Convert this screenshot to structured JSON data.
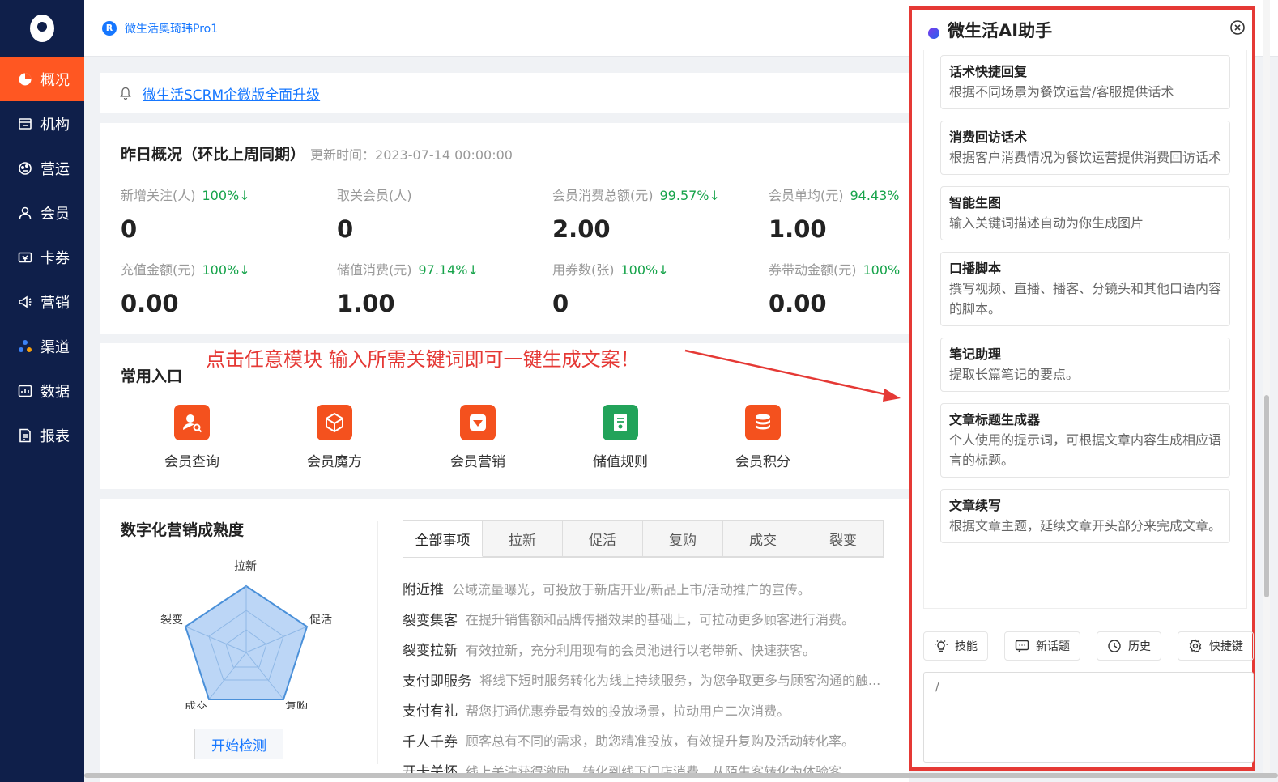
{
  "sidebar": {
    "items": [
      {
        "label": "概况",
        "icon": "pie-chart-icon",
        "active": true
      },
      {
        "label": "机构",
        "icon": "building-icon"
      },
      {
        "label": "营运",
        "icon": "operations-icon"
      },
      {
        "label": "会员",
        "icon": "user-icon"
      },
      {
        "label": "卡券",
        "icon": "coupon-icon"
      },
      {
        "label": "营销",
        "icon": "megaphone-icon"
      },
      {
        "label": "渠道",
        "icon": "channel-icon"
      },
      {
        "label": "数据",
        "icon": "data-icon"
      },
      {
        "label": "报表",
        "icon": "report-icon"
      }
    ],
    "active_color": "#ff5722",
    "bg_color": "#0f1f4a"
  },
  "topbar": {
    "org_badge": "R",
    "org_name": "微生活奥琦玮Pro1"
  },
  "notice": {
    "text": "微生活SCRM企微版全面升级"
  },
  "overview": {
    "title": "昨日概况（环比上周同期）",
    "update_time": "更新时间：2023-07-14 00:00:00",
    "metrics": [
      {
        "label": "新增关注(人)",
        "change": "100%↓",
        "value": "0"
      },
      {
        "label": "取关会员(人)",
        "change": "",
        "value": "0"
      },
      {
        "label": "会员消费总额(元)",
        "change": "99.57%↓",
        "value": "2.00"
      },
      {
        "label": "会员单均(元)",
        "change": "94.43%",
        "value": "1.00"
      },
      {
        "label": "充值金额(元)",
        "change": "100%↓",
        "value": "0.00"
      },
      {
        "label": "储值消费(元)",
        "change": "97.14%↓",
        "value": "1.00"
      },
      {
        "label": "用券数(张)",
        "change": "100%↓",
        "value": "0"
      },
      {
        "label": "券带动金额(元)",
        "change": "100%",
        "value": "0.00"
      }
    ],
    "positive_color": "#16a34a"
  },
  "entries": {
    "title": "常用入口",
    "callout": "点击任意模块 输入所需关键词即可一键生成文案！",
    "items": [
      {
        "label": "会员查询",
        "icon": "member-search-icon",
        "color": "#f4511e"
      },
      {
        "label": "会员魔方",
        "icon": "cube-icon",
        "color": "#f4511e"
      },
      {
        "label": "会员营销",
        "icon": "gem-icon",
        "color": "#f4511e"
      },
      {
        "label": "储值规则",
        "icon": "rules-icon",
        "color": "#22a35a"
      },
      {
        "label": "会员积分",
        "icon": "coins-icon",
        "color": "#f4511e"
      }
    ]
  },
  "maturity": {
    "title": "数字化营销成熟度",
    "radar_labels": [
      "拉新",
      "促活",
      "复购",
      "成交",
      "裂变"
    ],
    "detect_button": "开始检测",
    "tabs": [
      "全部事项",
      "拉新",
      "促活",
      "复购",
      "成交",
      "裂变"
    ],
    "rows": [
      {
        "name": "附近推",
        "desc": "公域流量曝光，可投放于新店开业/新品上市/活动推广的宣传。"
      },
      {
        "name": "裂变集客",
        "desc": "在提升销售额和品牌传播效果的基础上，可拉动更多顾客进行消费。"
      },
      {
        "name": "裂变拉新",
        "desc": "有效拉新，充分利用现有的会员池进行以老带新、快速获客。"
      },
      {
        "name": "支付即服务",
        "desc": "将线下短时服务转化为线上持续服务，为您争取更多与顾客沟通的触..."
      },
      {
        "name": "支付有礼",
        "desc": "帮您打通优惠券最有效的投放场景，拉动用户二次消费。"
      },
      {
        "name": "千人千券",
        "desc": "顾客总有不同的需求，助您精准投放，有效提升复购及活动转化率。"
      },
      {
        "name": "开卡关怀",
        "desc": "线上关注获得激励，转化到线下门店消费，从陌生客转化为体验客。"
      }
    ]
  },
  "ai_panel": {
    "title": "微生活AI助手",
    "skills": [
      {
        "name": "话术快捷回复",
        "desc": "根据不同场景为餐饮运营/客服提供话术"
      },
      {
        "name": "消费回访话术",
        "desc": "根据客户消费情况为餐饮运营提供消费回访话术"
      },
      {
        "name": "智能生图",
        "desc": "输入关键词描述自动为你生成图片"
      },
      {
        "name": "口播脚本",
        "desc": "撰写视频、直播、播客、分镜头和其他口语内容的脚本。"
      },
      {
        "name": "笔记助理",
        "desc": "提取长篇笔记的要点。"
      },
      {
        "name": "文章标题生成器",
        "desc": "个人使用的提示词，可根据文章内容生成相应语言的标题。"
      },
      {
        "name": "文章续写",
        "desc": "根据文章主题，延续文章开头部分来完成文章。"
      }
    ],
    "toolbar": [
      {
        "label": "技能",
        "icon": "bulb-icon"
      },
      {
        "label": "新话题",
        "icon": "chat-icon"
      },
      {
        "label": "历史",
        "icon": "history-icon"
      },
      {
        "label": "快捷键",
        "icon": "settings-icon"
      }
    ],
    "input_placeholder": "/",
    "border_color": "#e53935"
  }
}
